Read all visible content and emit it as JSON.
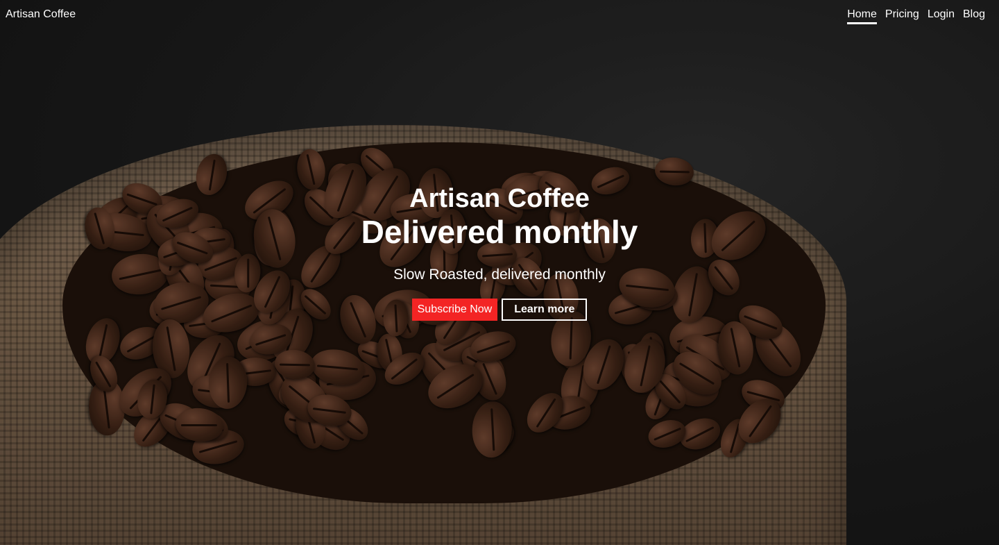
{
  "brand": "Artisan Coffee",
  "nav": {
    "items": [
      {
        "label": "Home",
        "active": true
      },
      {
        "label": "Pricing"
      },
      {
        "label": "Login"
      },
      {
        "label": "Blog"
      }
    ]
  },
  "hero": {
    "title_line1": "Artisan Coffee",
    "title_line2": "Delivered monthly",
    "subtitle": "Slow Roasted, delivered monthly",
    "primary_button": "Subscribe Now",
    "secondary_button": "Learn more"
  },
  "colors": {
    "accent": "#f32424",
    "text": "#ffffff",
    "background": "#1a1a1a"
  }
}
